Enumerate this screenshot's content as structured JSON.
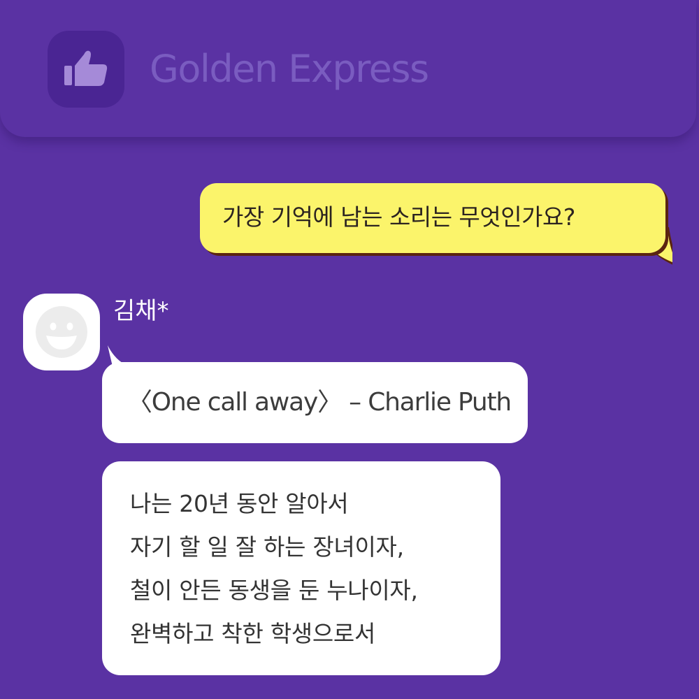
{
  "header": {
    "app_title": "Golden Express",
    "icon": "thumbs-up-icon"
  },
  "question": {
    "text": "가장 기억에 남는 소리는 무엇인가요?"
  },
  "reply": {
    "sender_name": "김채*",
    "avatar_icon": "smiley-face-icon",
    "messages": [
      "〈One call away〉 – Charlie Puth"
    ],
    "long_message_lines": [
      "나는 20년 동안 알아서",
      "자기 할 일 잘 하는 장녀이자,",
      "철이 안든 동생을 둔 누나이자,",
      "완벽하고 착한 학생으로서"
    ]
  },
  "colors": {
    "background": "#5a32a3",
    "question_bubble": "#fbf46b",
    "answer_bubble": "#ffffff",
    "title_text": "#7a5cc0"
  }
}
